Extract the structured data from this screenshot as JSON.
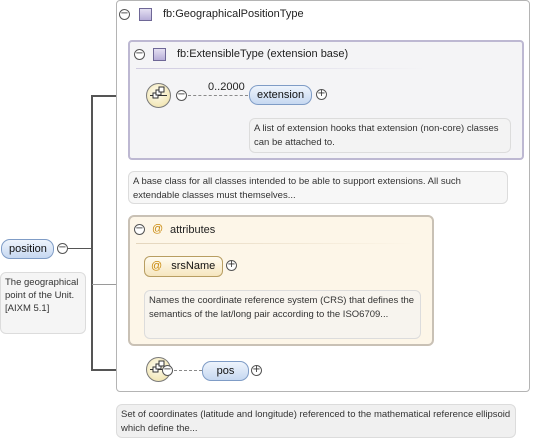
{
  "root": {
    "label": "position",
    "doc": "The geographical point of the Unit. [AIXM 5.1]"
  },
  "type_box": {
    "title": "fb:GeographicalPositionType",
    "doc": "Set of coordinates (latitude and longitude) referenced to the mathematical reference ellipsoid which define the..."
  },
  "ext_box": {
    "title": "fb:ExtensibleType (extension base)",
    "cardinality": "0..2000",
    "element_label": "extension",
    "element_doc": "A list of extension hooks that extension (non-core) classes can be attached to.",
    "doc": "A base class for all classes intended to be able to support extensions. All such extendable classes must themselves..."
  },
  "attributes": {
    "title": "attributes",
    "at_symbol": "@",
    "attr_label": "srsName",
    "attr_doc": "Names the coordinate reference system (CRS) that defines the semantics of the lat/long pair according to the ISO6709..."
  },
  "pos": {
    "label": "pos"
  },
  "glyphs": {
    "collapse": "−",
    "expand": "+"
  },
  "colors": {
    "element_fill": "#c6d8f1",
    "attribute_fill": "#f6e6bf",
    "type_square": "#b7aed8",
    "sequence_fill": "#f2e7b8"
  },
  "icons": [
    "collapse-icon",
    "expand-icon",
    "complex-type-icon",
    "sequence-compositor-icon",
    "attribute-icon"
  ]
}
